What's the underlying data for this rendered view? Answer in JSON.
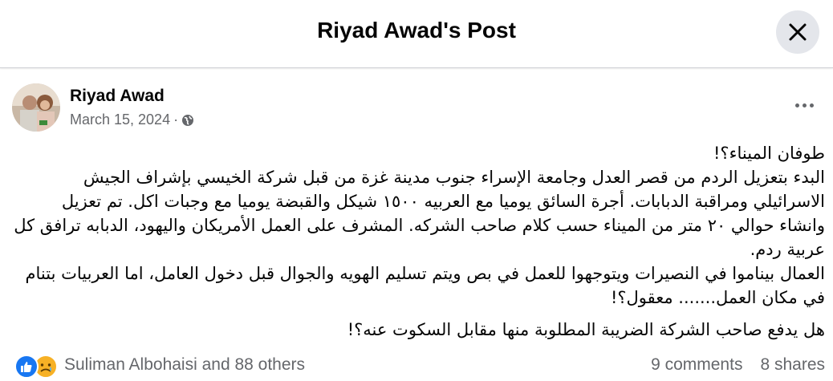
{
  "header": {
    "title": "Riyad Awad's Post"
  },
  "post": {
    "author": "Riyad Awad",
    "date": "March 15, 2024",
    "separator": "·",
    "privacy_icon": "globe-icon",
    "paragraphs": [
      "طوفان الميناء؟!",
      "البدء بتعزيل الردم من قصر العدل وجامعة الإسراء جنوب مدينة غزة من قبل شركة الخيسي بإشراف الجيش الاسرائيلي ومراقبة الدبابات. أجرة السائق يوميا مع العربيه ١٥٠٠ شيكل والقبضة يوميا مع وجبات اكل. تم تعزيل وانشاء حوالي ٢٠ متر من الميناء حسب كلام صاحب الشركه. المشرف على العمل الأمريكان واليهود، الدبابه ترافق كل عربية ردم.",
      "العمال بيناموا في النصيرات ويتوجهوا للعمل في بص ويتم تسليم الهويه والجوال قبل دخول العامل، اما العربيات بتنام في مكان العمل....... معقول؟!",
      "هل يدفع صاحب الشركة الضريبة المطلوبة منها مقابل السكوت عنه؟!"
    ]
  },
  "reactions": {
    "icons": [
      "like-icon",
      "sad-icon"
    ],
    "label": "Suliman Albohaisi and 88 others"
  },
  "stats": {
    "comments": "9 comments",
    "shares": "8 shares"
  },
  "colors": {
    "like_blue": "#1877f2",
    "sad_yellow": "#f7b125",
    "secondary_text": "#65676b"
  }
}
